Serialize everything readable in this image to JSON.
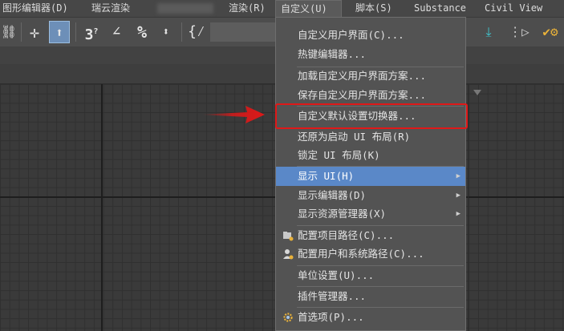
{
  "menubar": {
    "items": [
      {
        "label": "图形编辑器(D)"
      },
      {
        "label": "瑞云渲染"
      },
      {
        "label": "渲染(R)"
      },
      {
        "label": "自定义(U)"
      },
      {
        "label": "脚本(S)"
      },
      {
        "label": "Substance"
      },
      {
        "label": "Civil View"
      }
    ]
  },
  "toolbar": {
    "icons": [
      "link-icon",
      "move-icon",
      "select-icon",
      "snap-3d-icon",
      "angle-snap-icon",
      "percent-snap-icon",
      "spinner-snap-icon",
      "edit-named-selection-icon",
      "mirror-icon",
      "align-icon",
      "render-setup-icon"
    ]
  },
  "dropdown": {
    "items": [
      {
        "label": "自定义用户界面(C)...",
        "submenu": false
      },
      {
        "label": "热键编辑器...",
        "submenu": false
      },
      {
        "label": "加载自定义用户界面方案...",
        "submenu": false
      },
      {
        "label": "保存自定义用户界面方案...",
        "submenu": false
      },
      {
        "label": "自定义默认设置切换器...",
        "submenu": false
      },
      {
        "label": "还原为启动 UI 布局(R)",
        "submenu": false
      },
      {
        "label": "锁定 UI 布局(K)",
        "submenu": false
      },
      {
        "label": "显示 UI(H)",
        "submenu": true,
        "highlighted": true
      },
      {
        "label": "显示编辑器(D)",
        "submenu": true
      },
      {
        "label": "显示资源管理器(X)",
        "submenu": true
      },
      {
        "label": "配置项目路径(C)...",
        "submenu": false,
        "icon": "project-folder-icon"
      },
      {
        "label": "配置用户和系统路径(C)...",
        "submenu": false,
        "icon": "user-path-icon"
      },
      {
        "label": "单位设置(U)...",
        "submenu": false
      },
      {
        "label": "插件管理器...",
        "submenu": false
      },
      {
        "label": "首选项(P)...",
        "submenu": false,
        "icon": "gear-icon"
      }
    ]
  },
  "colors": {
    "highlight": "#5a88c8",
    "annotation_red": "#e01818"
  }
}
